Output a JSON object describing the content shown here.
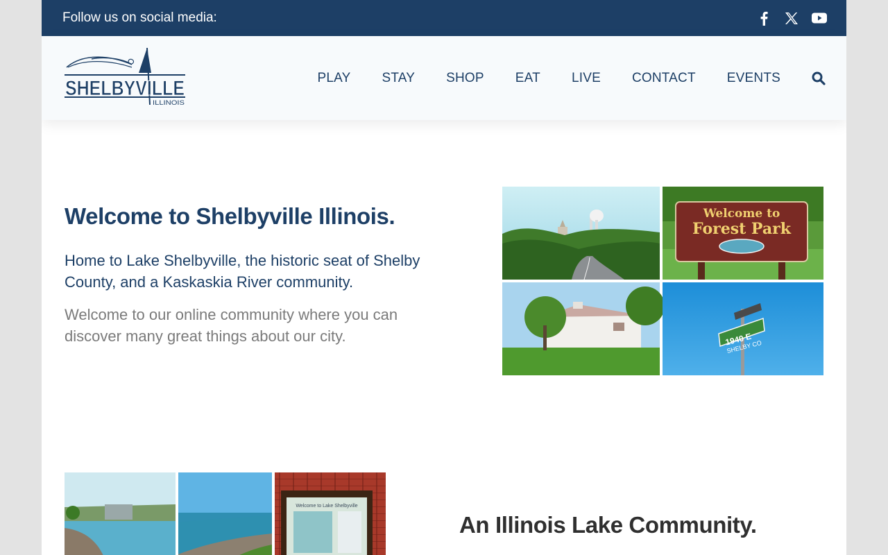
{
  "topbar": {
    "follow_text": "Follow us on social media:",
    "social": [
      {
        "name": "facebook-icon"
      },
      {
        "name": "x-icon"
      },
      {
        "name": "youtube-icon"
      }
    ]
  },
  "header": {
    "logo": {
      "text": "SHELBYVILLE",
      "subtext": "ILLINOIS"
    },
    "nav": [
      "PLAY",
      "STAY",
      "SHOP",
      "EAT",
      "LIVE",
      "CONTACT",
      "EVENTS"
    ],
    "search_icon": "search-icon"
  },
  "welcome": {
    "title": "Welcome to Shelbyville Illinois.",
    "lead": "Home to Lake Shelbyville, the historic seat of Shelby County, and a Kaskaskia River community.",
    "body": "Welcome to our online community where you can discover many great things about our city.",
    "photo_texts": {
      "sign_line1": "Welcome to",
      "sign_line2": "Forest Park",
      "street_number": "1940 E",
      "street_name": "SHELBY CO"
    }
  },
  "lake": {
    "title": "An Illinois Lake Community.",
    "photo_texts": {
      "board_title": "Welcome to Lake Shelbyville"
    }
  },
  "colors": {
    "navy": "#1d3f66",
    "header_bg": "#f7fafc",
    "body_gray": "#7a7a7a",
    "heading_dark": "#2f2f2f"
  }
}
